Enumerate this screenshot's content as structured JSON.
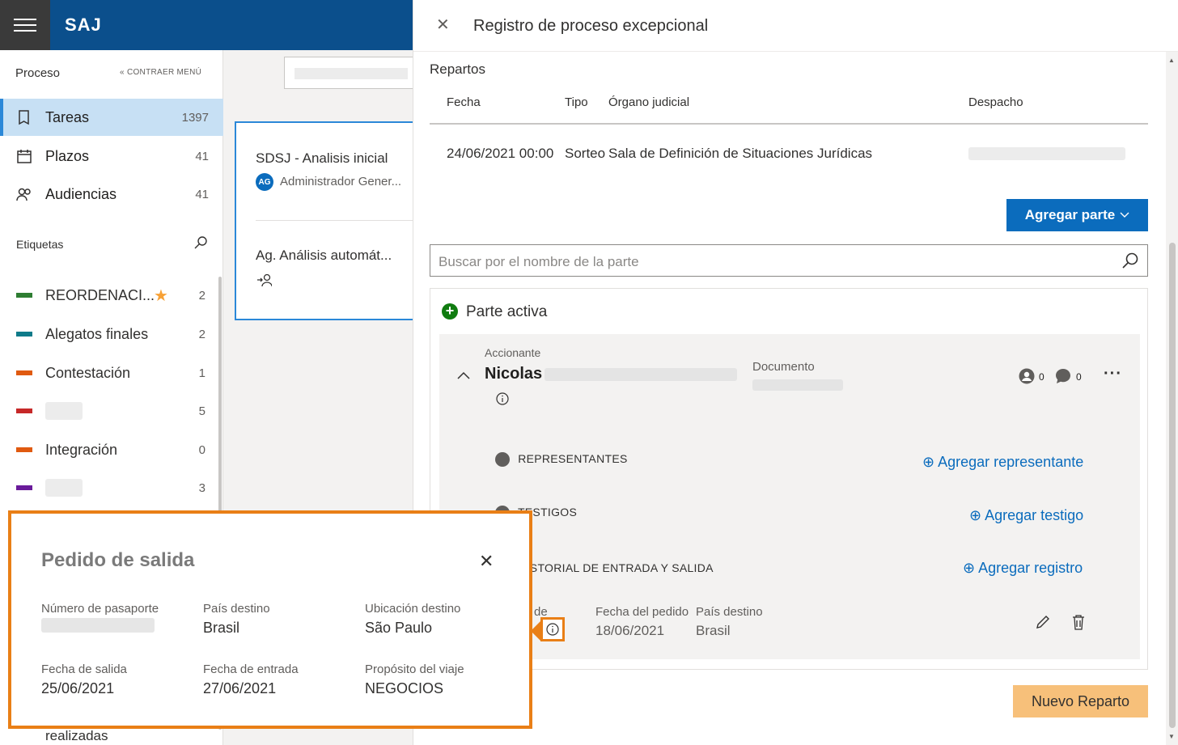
{
  "app": {
    "title": "SAJ"
  },
  "sidebar": {
    "heading": "Proceso",
    "collapse_label": "CONTRAER MENÚ",
    "items": [
      {
        "label": "Tareas",
        "count": "1397"
      },
      {
        "label": "Plazos",
        "count": "41"
      },
      {
        "label": "Audiencias",
        "count": "41"
      }
    ],
    "labels_heading": "Etiquetas",
    "tags": [
      {
        "label": "REORDENACI...",
        "count": "2",
        "color": "#2e7d32"
      },
      {
        "label": "Alegatos finales",
        "count": "2",
        "color": "#0f7b8a"
      },
      {
        "label": "Contestación",
        "count": "1",
        "color": "#e05a10"
      },
      {
        "label": "",
        "count": "5",
        "color": "#c62828"
      },
      {
        "label": "Integración",
        "count": "0",
        "color": "#e05a10"
      },
      {
        "label": "",
        "count": "3",
        "color": "#6a1b9a"
      }
    ],
    "footer_text": "realizadas"
  },
  "middle": {
    "card": {
      "title1": "SDSJ - Analisis inicial",
      "avatar": "AG",
      "assignee": "Administrador Gener...",
      "title2": "Ag. Análisis automát..."
    }
  },
  "panel": {
    "title": "Registro de proceso excepcional",
    "repartos": {
      "title": "Repartos",
      "headers": {
        "fecha": "Fecha",
        "tipo": "Tipo",
        "organo": "Órgano judicial",
        "despacho": "Despacho"
      },
      "row": {
        "fecha": "24/06/2021 00:00",
        "tipo": "Sorteo",
        "organo": "Sala de Definición de Situaciones Jurídicas"
      }
    },
    "add_party_button": "Agregar parte",
    "search_placeholder": "Buscar por el nombre de la parte",
    "party": {
      "section_title": "Parte activa",
      "role": "Accionante",
      "name": "Nicolas",
      "document_label": "Documento",
      "representatives_count": "0",
      "comments_count": "0",
      "representantes": "REPRESENTANTES",
      "add_representante": "Agregar representante",
      "testigos": "TESTIGOS",
      "add_testigo": "Agregar testigo",
      "historial": "HISTORIAL DE ENTRADA Y SALIDA",
      "add_registro": "Agregar registro",
      "record": {
        "type_partial": "de",
        "fecha_pedido_label": "Fecha del pedido",
        "fecha_pedido": "18/06/2021",
        "pais_label": "País destino",
        "pais": "Brasil"
      }
    },
    "new_reparto_button": "Nuevo Reparto"
  },
  "popup": {
    "title": "Pedido de salida",
    "fields": {
      "pasaporte_label": "Número de pasaporte",
      "pais_label": "País destino",
      "pais_value": "Brasil",
      "ubicacion_label": "Ubicación destino",
      "ubicacion_value": "São Paulo",
      "salida_label": "Fecha de salida",
      "salida_value": "25/06/2021",
      "entrada_label": "Fecha de entrada",
      "entrada_value": "27/06/2021",
      "proposito_label": "Propósito del viaje",
      "proposito_value": "NEGOCIOS"
    }
  }
}
